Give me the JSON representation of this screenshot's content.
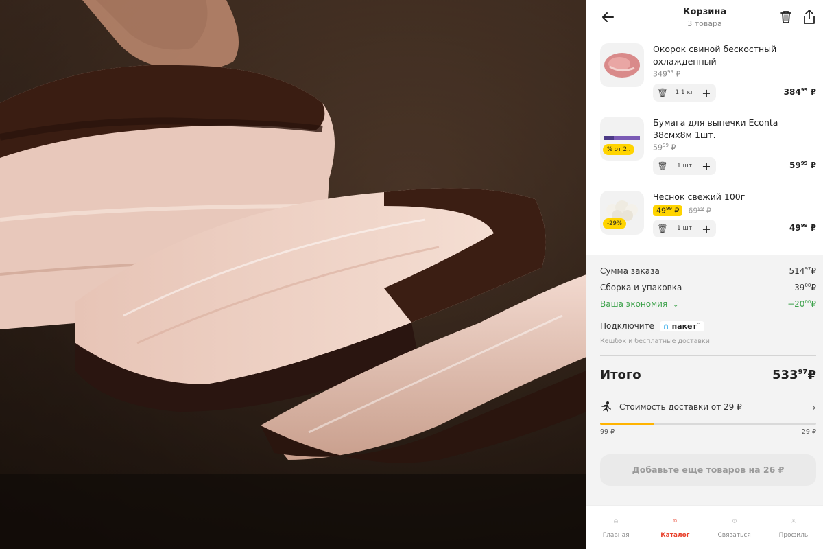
{
  "header": {
    "title": "Корзина",
    "subtitle": "3 товара"
  },
  "cart": {
    "items": [
      {
        "name": "Окорок свиной бескостный охлажденный",
        "price_main": "349",
        "price_cents": "99",
        "currency": "₽",
        "qty": "1.1 кг",
        "total_main": "384",
        "total_cents": "99"
      },
      {
        "name": "Бумага для выпечки Econta 38смх8м 1шт.",
        "price_main": "59",
        "price_cents": "99",
        "currency": "₽",
        "badge": "% от 2..",
        "qty": "1 шт",
        "total_main": "59",
        "total_cents": "99"
      },
      {
        "name": "Чеснок свежий 100г",
        "price_new_main": "49",
        "price_new_cents": "99",
        "price_old_main": "69",
        "price_old_cents": "99",
        "currency": "₽",
        "badge": "-29%",
        "qty": "1 шт",
        "total_main": "49",
        "total_cents": "99"
      }
    ]
  },
  "summary": {
    "order_sum_label": "Сумма заказа",
    "order_sum_main": "514",
    "order_sum_cents": "97",
    "packing_label": "Сборка и упаковка",
    "packing_main": "39",
    "packing_cents": "00",
    "savings_label": "Ваша экономия",
    "savings_main": "−20",
    "savings_cents": "00",
    "currency": "₽",
    "connect_label": "Подключите",
    "paket_name": "пакет",
    "paket_tm": "™",
    "paket_hint": "Кешбэк и бесплатные доставки",
    "total_label": "Итого",
    "total_main": "533",
    "total_cents": "97",
    "delivery_label": "Стоимость доставки от 29 ₽",
    "progress_left": "99 ₽",
    "progress_right": "29 ₽",
    "progress_fraction": 0.25,
    "cta_label": "Добавьте еще товаров на 26 ₽"
  },
  "tabbar": {
    "tabs": [
      {
        "label": "Главная",
        "icon": "home-icon"
      },
      {
        "label": "Каталог",
        "icon": "catalog-search-icon",
        "active": true
      },
      {
        "label": "Связаться",
        "icon": "help-icon"
      },
      {
        "label": "Профиль",
        "icon": "profile-icon"
      }
    ]
  },
  "colors": {
    "accent": "#e8412c",
    "badge_yellow": "#ffd400",
    "savings_green": "#3fa34d",
    "progress_orange": "#ffb300"
  }
}
